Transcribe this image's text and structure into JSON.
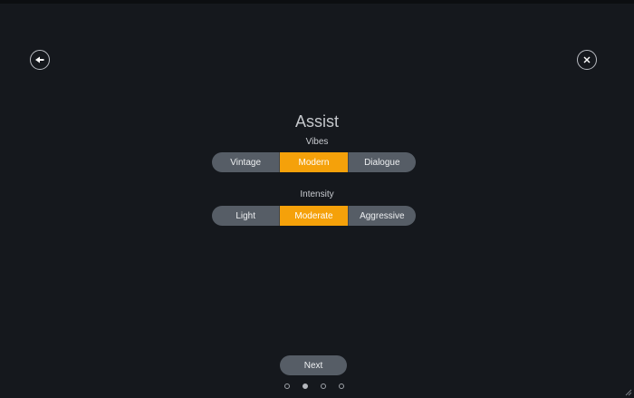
{
  "screen": {
    "title": "Assist",
    "accent_color": "#f5a10a"
  },
  "header": {
    "back_icon": "back-arrow-icon",
    "close_icon": "close-icon"
  },
  "vibes": {
    "label": "Vibes",
    "options": [
      "Vintage",
      "Modern",
      "Dialogue"
    ],
    "selected": "Modern"
  },
  "intensity": {
    "label": "Intensity",
    "options": [
      "Light",
      "Moderate",
      "Aggressive"
    ],
    "selected": "Moderate"
  },
  "footer": {
    "next_label": "Next",
    "pages_total": 4,
    "current_page": 2
  }
}
